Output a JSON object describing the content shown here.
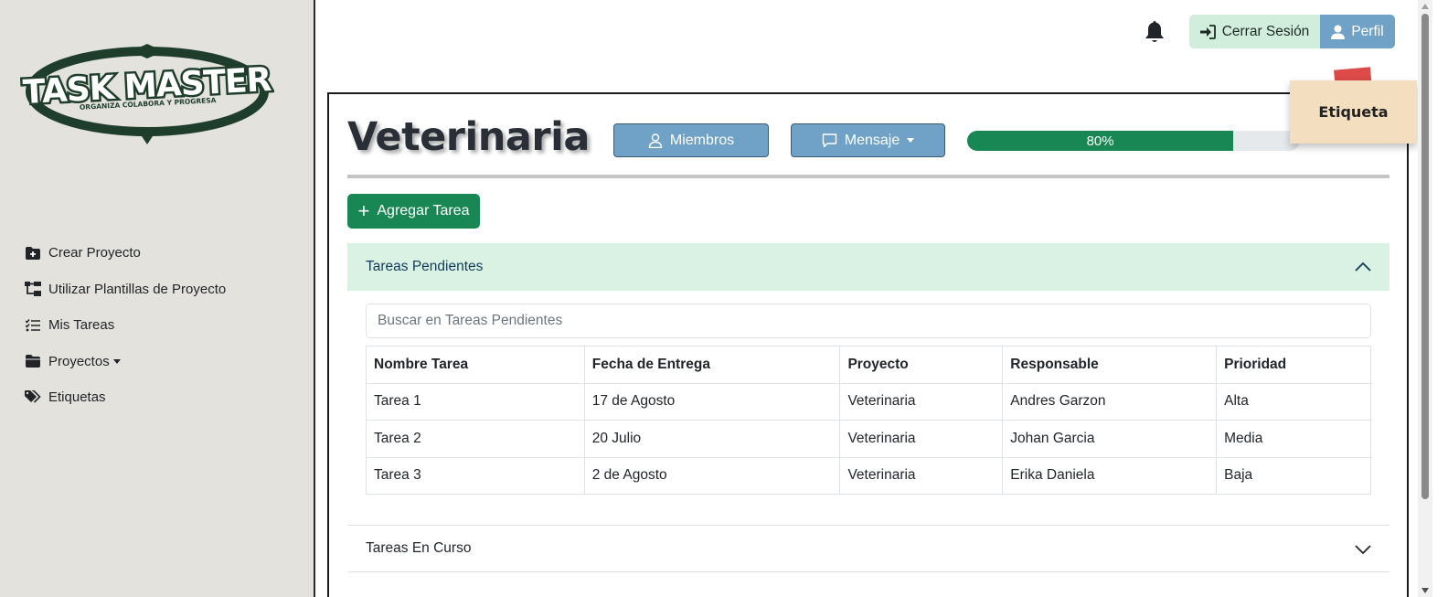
{
  "sidebar": {
    "logo_text": "TASK MASTER",
    "logo_tagline": "ORGANIZA COLABORA Y PROGRESA",
    "items": [
      {
        "label": "Crear Proyecto",
        "icon": "folder-plus-icon"
      },
      {
        "label": "Utilizar Plantillas de Proyecto",
        "icon": "diagram-tree-icon"
      },
      {
        "label": "Mis Tareas",
        "icon": "list-check-icon"
      },
      {
        "label": "Proyectos",
        "icon": "folder-icon",
        "dropdown": true
      },
      {
        "label": "Etiquetas",
        "icon": "tags-icon"
      }
    ]
  },
  "topbar": {
    "logout_label": "Cerrar Sesión",
    "profile_label": "Perfil",
    "bell_icon": "bell-icon"
  },
  "project": {
    "title": "Veterinaria",
    "members_label": "Miembros",
    "message_label": "Mensaje",
    "progress": 80,
    "progress_label": "80%",
    "add_task_label": "Agregar Tarea",
    "sticky_label": "Etiqueta"
  },
  "colors": {
    "sidebar_bg": "#e3e2dd",
    "primary_green": "#198754",
    "light_green": "#d9f2e3",
    "steel_blue": "#6fa2c6",
    "sticky_note": "#f3dfbf",
    "sticky_tab": "#dc4a4a"
  },
  "pending": {
    "header": "Tareas Pendientes",
    "search_placeholder": "Buscar en Tareas Pendientes",
    "columns": [
      "Nombre Tarea",
      "Fecha de Entrega",
      "Proyecto",
      "Responsable",
      "Prioridad"
    ],
    "rows": [
      [
        "Tarea 1",
        "17 de Agosto",
        "Veterinaria",
        "Andres Garzon",
        "Alta"
      ],
      [
        "Tarea 2",
        "20 Julio",
        "Veterinaria",
        "Johan Garcia",
        "Media"
      ],
      [
        "Tarea 3",
        "2 de Agosto",
        "Veterinaria",
        "Erika Daniela",
        "Baja"
      ]
    ]
  },
  "in_progress": {
    "header": "Tareas En Curso"
  }
}
